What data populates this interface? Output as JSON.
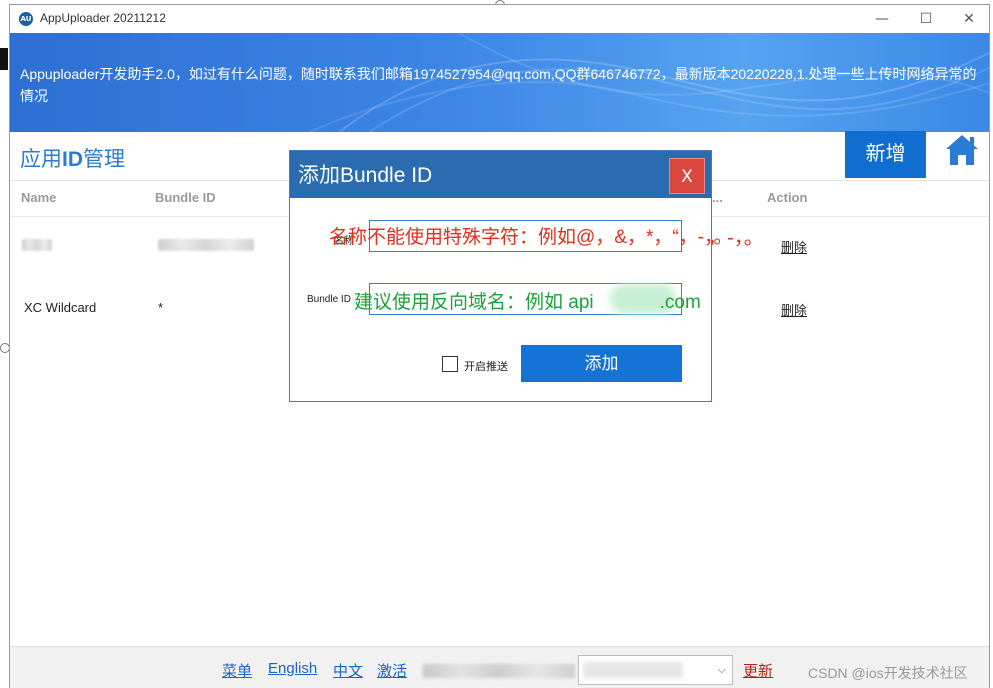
{
  "window": {
    "logo_text": "AU",
    "title": "AppUploader 20211212",
    "minimize": "—",
    "maximize": "☐",
    "close": "✕"
  },
  "banner": {
    "text": "Appuploader开发助手2.0，如过有什么问题，随时联系我们邮箱1974527954@qq.com,QQ群646746772，最新版本20220228,1.处理一些上传时网络异常的情况"
  },
  "header": {
    "title_prefix": "应用",
    "title_bold": "ID",
    "title_suffix": "管理",
    "add_button": "新增"
  },
  "table": {
    "columns": [
      "Name",
      "Bundle ID",
      "...",
      "Action"
    ],
    "rows": [
      {
        "name": "",
        "bundle_id": "",
        "action": "删除"
      },
      {
        "name": "XC Wildcard",
        "bundle_id": "*",
        "action": "删除"
      }
    ]
  },
  "dialog": {
    "title": "添加Bundle ID",
    "close_label": "X",
    "name_label": "名称",
    "bundle_label": "Bundle ID",
    "name_hint": "名称不能使用特殊字符：例如@，&，*，“，-，。",
    "bundle_hint_pre": "建议使用反向域名：例如 api",
    "bundle_hint_post": ".com",
    "checkbox_label": "开启推送",
    "submit": "添加",
    "overflow_text": "\"，-，。"
  },
  "footer": {
    "links": [
      "菜单",
      "English",
      "中文",
      "激活"
    ],
    "update": "更新",
    "watermark": "CSDN @ios开发技术社区"
  },
  "colors": {
    "primary": "#0f6ecf",
    "dialog_header": "#2b6cb0",
    "close_red": "#d9473f",
    "hint_red": "#e0301e",
    "hint_green": "#1aa33a",
    "link_blue": "#1a64c8"
  }
}
